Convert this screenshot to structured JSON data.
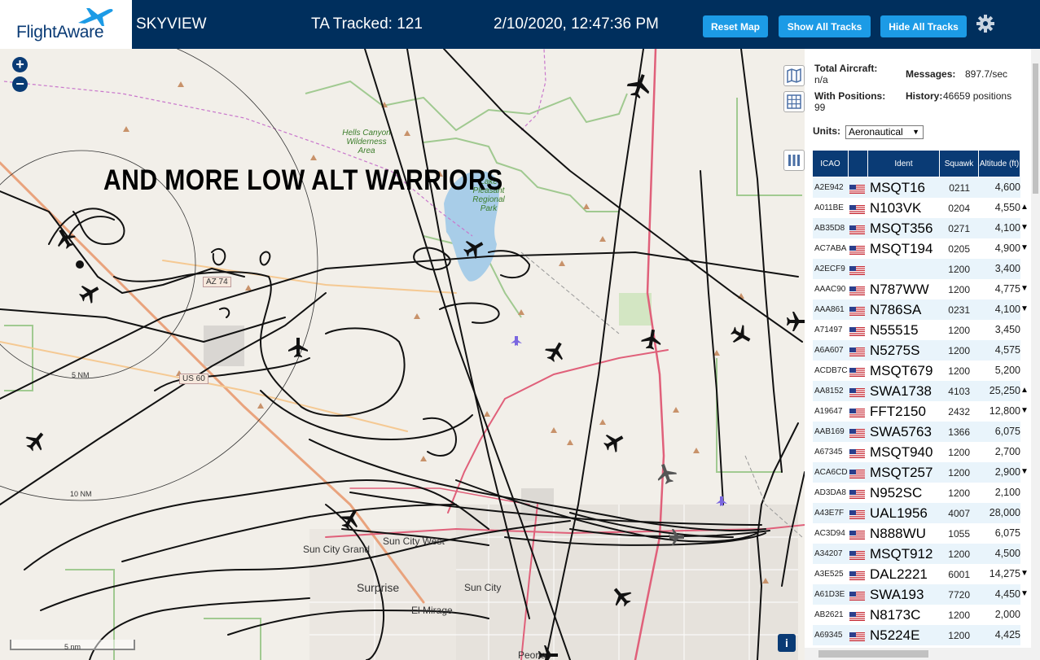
{
  "header": {
    "logo_text": "FlightAware",
    "app_name": "SKYVIEW",
    "tracked": "TA Tracked: 121",
    "datetime": "2/10/2020, 12:47:36 PM",
    "reset_label": "Reset Map",
    "show_label": "Show All Tracks",
    "hide_label": "Hide All Tracks"
  },
  "map": {
    "overlay_text": "AND MORE LOW ALT WARRIORS",
    "area_label": "Hells Canyon Wilderness Area",
    "park_label": "Lake Pleasant Regional Park",
    "route_az74": "AZ 74",
    "route_us60": "US 60",
    "range_5": "5 NM",
    "range_10": "10 NM",
    "scale": "5 nm",
    "info": "i",
    "cities": [
      "Sun City West",
      "Sun City Grand",
      "Surprise",
      "Sun City",
      "El Mirage",
      "Peoria"
    ],
    "colors": {
      "track": "#111111",
      "park": "#8cc07a",
      "water": "#a8cde8",
      "highway": "#e0607a"
    }
  },
  "stats": {
    "total_label": "Total Aircraft:",
    "total_value": "n/a",
    "positions_label": "With Positions:",
    "positions_value": "99",
    "messages_label": "Messages:",
    "messages_value": "897.7/sec",
    "history_label": "History:",
    "history_value": "46659 positions",
    "units_label": "Units:",
    "units_value": "Aeronautical"
  },
  "table": {
    "headers": [
      "ICAO",
      "",
      "Ident",
      "Squawk",
      "Altitude (ft)"
    ],
    "rows": [
      {
        "icao": "A2E942",
        "ident": "MSQT16",
        "squawk": "0211",
        "alt": "4,600",
        "arrow": ""
      },
      {
        "icao": "A011BE",
        "ident": "N103VK",
        "squawk": "0204",
        "alt": "4,550",
        "arrow": "▲"
      },
      {
        "icao": "AB35D8",
        "ident": "MSQT356",
        "squawk": "0271",
        "alt": "4,100",
        "arrow": "▼"
      },
      {
        "icao": "AC7ABA",
        "ident": "MSQT194",
        "squawk": "0205",
        "alt": "4,900",
        "arrow": "▼"
      },
      {
        "icao": "A2ECF9",
        "ident": "",
        "squawk": "1200",
        "alt": "3,400",
        "arrow": ""
      },
      {
        "icao": "AAAC90",
        "ident": "N787WW",
        "squawk": "1200",
        "alt": "4,775",
        "arrow": "▼"
      },
      {
        "icao": "AAA861",
        "ident": "N786SA",
        "squawk": "0231",
        "alt": "4,100",
        "arrow": "▼"
      },
      {
        "icao": "A71497",
        "ident": "N55515",
        "squawk": "1200",
        "alt": "3,450",
        "arrow": ""
      },
      {
        "icao": "A6A607",
        "ident": "N5275S",
        "squawk": "1200",
        "alt": "4,575",
        "arrow": ""
      },
      {
        "icao": "ACDB7C",
        "ident": "MSQT679",
        "squawk": "1200",
        "alt": "5,200",
        "arrow": ""
      },
      {
        "icao": "AA8152",
        "ident": "SWA1738",
        "squawk": "4103",
        "alt": "25,250",
        "arrow": "▲"
      },
      {
        "icao": "A19647",
        "ident": "FFT2150",
        "squawk": "2432",
        "alt": "12,800",
        "arrow": "▼"
      },
      {
        "icao": "AAB169",
        "ident": "SWA5763",
        "squawk": "1366",
        "alt": "6,075",
        "arrow": ""
      },
      {
        "icao": "A67345",
        "ident": "MSQT940",
        "squawk": "1200",
        "alt": "2,700",
        "arrow": ""
      },
      {
        "icao": "ACA6CD",
        "ident": "MSQT257",
        "squawk": "1200",
        "alt": "2,900",
        "arrow": "▼"
      },
      {
        "icao": "AD3DA8",
        "ident": "N952SC",
        "squawk": "1200",
        "alt": "2,100",
        "arrow": ""
      },
      {
        "icao": "A43E7F",
        "ident": "UAL1956",
        "squawk": "4007",
        "alt": "28,000",
        "arrow": ""
      },
      {
        "icao": "AC3D94",
        "ident": "N888WU",
        "squawk": "1055",
        "alt": "6,075",
        "arrow": ""
      },
      {
        "icao": "A34207",
        "ident": "MSQT912",
        "squawk": "1200",
        "alt": "4,500",
        "arrow": ""
      },
      {
        "icao": "A3E525",
        "ident": "DAL2221",
        "squawk": "6001",
        "alt": "14,275",
        "arrow": "▼"
      },
      {
        "icao": "A61D3E",
        "ident": "SWA193",
        "squawk": "7720",
        "alt": "4,450",
        "arrow": "▼"
      },
      {
        "icao": "AB2621",
        "ident": "N8173C",
        "squawk": "1200",
        "alt": "2,000",
        "arrow": ""
      },
      {
        "icao": "A69345",
        "ident": "N5224E",
        "squawk": "1200",
        "alt": "4,425",
        "arrow": ""
      }
    ]
  }
}
